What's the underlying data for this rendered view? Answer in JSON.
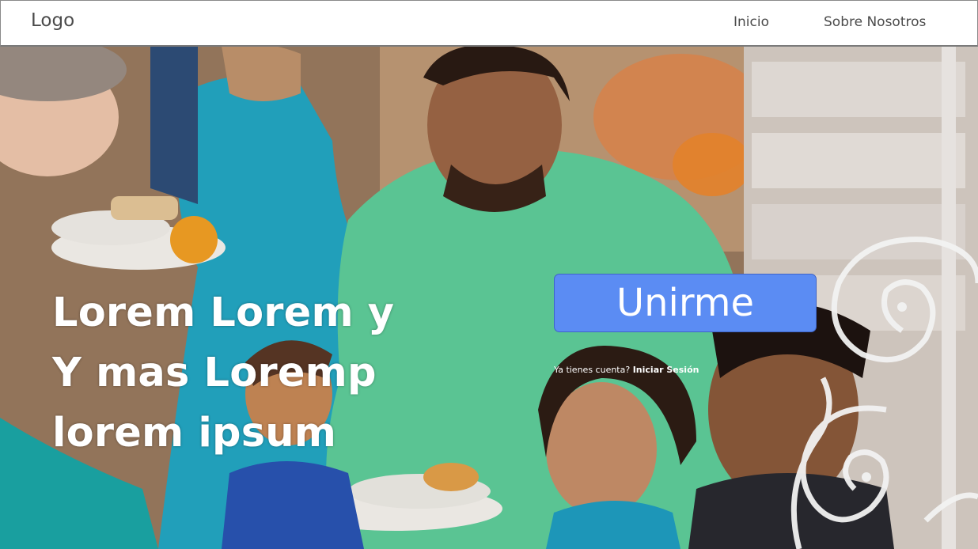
{
  "header": {
    "logo": "Logo",
    "nav": [
      {
        "label": "Inicio"
      },
      {
        "label": "Sobre Nosotros"
      }
    ]
  },
  "hero": {
    "headline": "Lorem Lorem y Y mas Loremp lorem ipsum",
    "join_label": "Unirme",
    "account_prompt": "Ya tienes cuenta?",
    "login_label": "Iniciar Sesión"
  },
  "colors": {
    "join_button": "#5b8cf3",
    "header_bg": "#ffffff",
    "nav_text": "#4b4b4b"
  }
}
